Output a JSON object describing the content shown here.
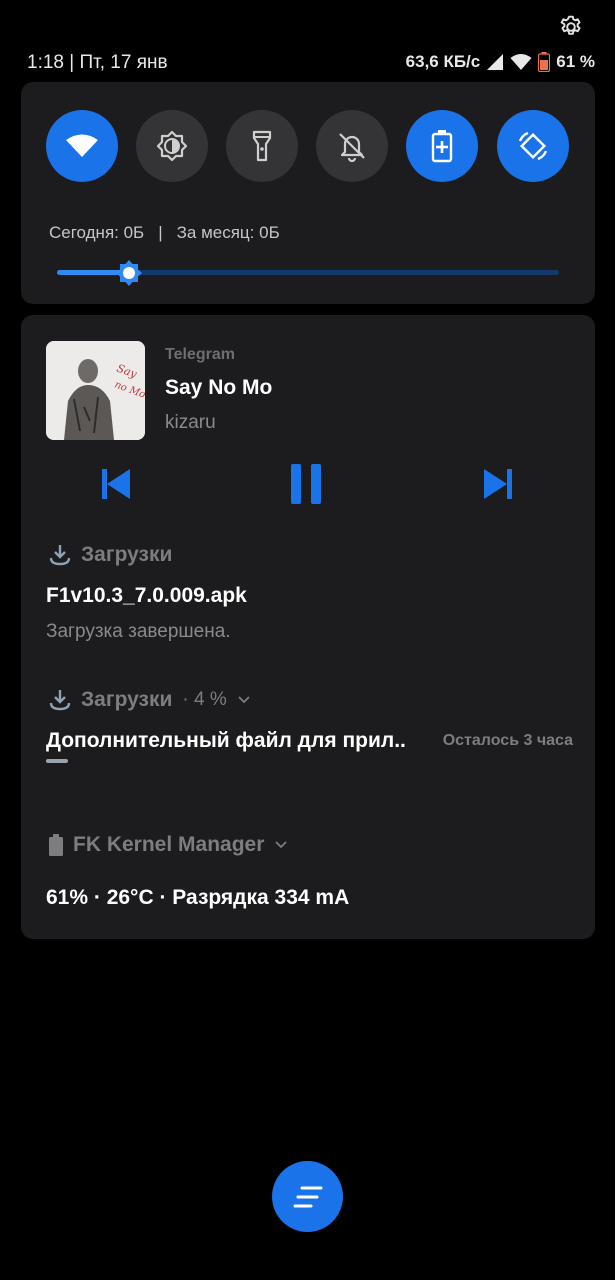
{
  "status_bar": {
    "time_date": "1:18 | Пт, 17 янв",
    "net_speed": "63,6 КБ/с",
    "battery": "61 %",
    "icons": [
      "gear-icon",
      "signal-icon",
      "wifi-icon",
      "battery-icon"
    ]
  },
  "quick_settings": {
    "tiles": [
      {
        "name": "wifi",
        "icon": "wifi-icon",
        "active": true
      },
      {
        "name": "auto-brightness",
        "icon": "brightness-icon",
        "active": false
      },
      {
        "name": "flashlight",
        "icon": "flashlight-icon",
        "active": false
      },
      {
        "name": "silent",
        "icon": "bell-off-icon",
        "active": false
      },
      {
        "name": "battery-saver",
        "icon": "battery-plus-icon",
        "active": true
      },
      {
        "name": "auto-rotate",
        "icon": "rotate-icon",
        "active": true
      }
    ],
    "data_today": "Сегодня: 0Б",
    "separator": "|",
    "data_month": "За месяц: 0Б",
    "brightness_level": 0.14,
    "accent_color": "#1a73e8"
  },
  "media": {
    "app": "Telegram",
    "title": "Say No Mo",
    "artist": "kizaru",
    "album_art_text": "Say no Mo"
  },
  "downloads_done": {
    "header": "Загрузки",
    "file": "F1v10.3_7.0.009.apk",
    "status": "Загрузка завершена."
  },
  "downloads_progress": {
    "header": "Загрузки",
    "percent": "· 4 %",
    "file": "Дополнительный файл для прил..",
    "remaining": "Осталось 3 часа",
    "progress": 0.04
  },
  "fk_kernel": {
    "app": "FK Kernel Manager",
    "info": "61% · 26°C · Разрядка 334 mA"
  }
}
